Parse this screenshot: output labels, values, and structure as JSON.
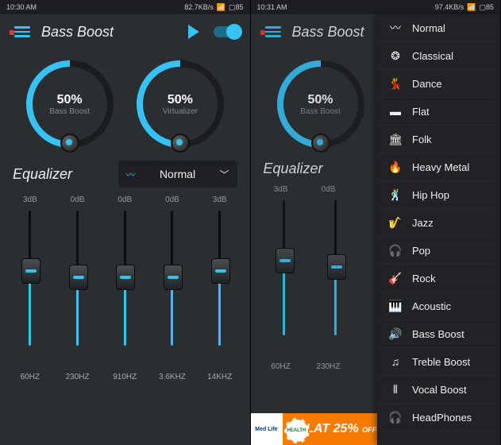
{
  "screen1": {
    "status": {
      "time": "10:30 AM",
      "speed": "82.7KB/s",
      "battery": "85"
    },
    "title": "Bass Boost",
    "dials": [
      {
        "value": "50%",
        "label": "Bass Boost",
        "percent": 50
      },
      {
        "value": "50%",
        "label": "Virtualizer",
        "percent": 50
      }
    ],
    "equalizer_label": "Equalizer",
    "preset": {
      "icon": "wave",
      "label": "Normal"
    },
    "db_labels": [
      "3dB",
      "0dB",
      "0dB",
      "0dB",
      "3dB"
    ],
    "sliders": [
      {
        "freq": "60HZ",
        "pos": 55
      },
      {
        "freq": "230HZ",
        "pos": 50
      },
      {
        "freq": "910HZ",
        "pos": 50
      },
      {
        "freq": "3.6KHZ",
        "pos": 50
      },
      {
        "freq": "14KHZ",
        "pos": 55
      }
    ]
  },
  "screen2": {
    "status": {
      "time": "10:31 AM",
      "speed": "97.4KB/s",
      "battery": "85"
    },
    "title": "Bass Boost",
    "dials": [
      {
        "value": "50%",
        "label": "Bass Boost",
        "percent": 50
      }
    ],
    "equalizer_label": "Equalizer",
    "db_labels": [
      "3dB",
      "0dB"
    ],
    "sliders": [
      {
        "freq": "60HZ",
        "pos": 55
      },
      {
        "freq": "230HZ",
        "pos": 50
      }
    ],
    "presets": [
      {
        "icon": "〰",
        "label": "Normal"
      },
      {
        "icon": "❂",
        "label": "Classical"
      },
      {
        "icon": "💃",
        "label": "Dance"
      },
      {
        "icon": "▬",
        "label": "Flat"
      },
      {
        "icon": "🏛",
        "label": "Folk"
      },
      {
        "icon": "🔥",
        "label": "Heavy Metal"
      },
      {
        "icon": "🕺",
        "label": "Hip Hop"
      },
      {
        "icon": "🎷",
        "label": "Jazz"
      },
      {
        "icon": "🎧",
        "label": "Pop"
      },
      {
        "icon": "🎸",
        "label": "Rock"
      },
      {
        "icon": "🎹",
        "label": "Acoustic"
      },
      {
        "icon": "🔊",
        "label": "Bass Boost"
      },
      {
        "icon": "♫",
        "label": "Treble Boost"
      },
      {
        "icon": "⦀",
        "label": "Vocal Boost"
      },
      {
        "icon": "🎧",
        "label": "HeadPhones"
      }
    ],
    "ad": {
      "brand": "Med Life",
      "pct": "25%",
      "off": "OFF",
      "badge": "HEALTH"
    }
  }
}
